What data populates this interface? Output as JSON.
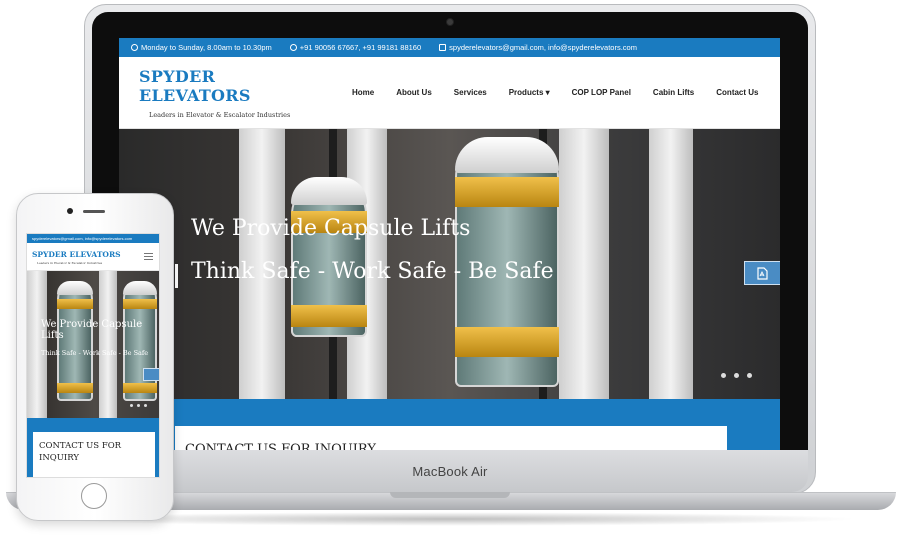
{
  "laptop": {
    "brand_label": "MacBook Air"
  },
  "site": {
    "topbar": {
      "hours": "Monday to Sunday, 8.00am to 10.30pm",
      "phones": "+91 90056 67667,  +91 99181 88160",
      "emails": "spyderelevators@gmail.com, info@spyderelevators.com"
    },
    "logo": {
      "title": "SPYDER ELEVATORS",
      "tagline": "Leaders in Elevator & Escalator Industries"
    },
    "nav": [
      {
        "label": "Home"
      },
      {
        "label": "About Us"
      },
      {
        "label": "Services"
      },
      {
        "label": "Products ▾"
      },
      {
        "label": "COP LOP Panel"
      },
      {
        "label": "Cabin Lifts"
      },
      {
        "label": "Contact Us"
      }
    ],
    "hero": {
      "headline": "We Provide Capsule Lifts",
      "subheadline": "Think Safe - Work Safe - Be Safe",
      "slide_count": 3
    },
    "contact_card_title": "CONTACT US FOR INQUIRY"
  },
  "mobile": {
    "topbar": "spyderelevators@gmail.com, info@spyderelevators.com",
    "logo": "SPYDER ELEVATORS",
    "tagline": "Leaders in Elevator & Escalator Industries",
    "hero_headline": "We Provide Capsule Lifts",
    "hero_sub": "Think Safe - Work Safe - Be Safe",
    "contact_title": "CONTACT US FOR INQUIRY"
  },
  "colors": {
    "brand_blue": "#1a7bc0",
    "pdf_button": "#4a8cc4",
    "gold": "#d9a42a"
  },
  "icons": [
    "clock-icon",
    "whatsapp-icon",
    "phone-icon",
    "envelope-icon",
    "pdf-icon",
    "hamburger-icon",
    "home-button-icon"
  ]
}
